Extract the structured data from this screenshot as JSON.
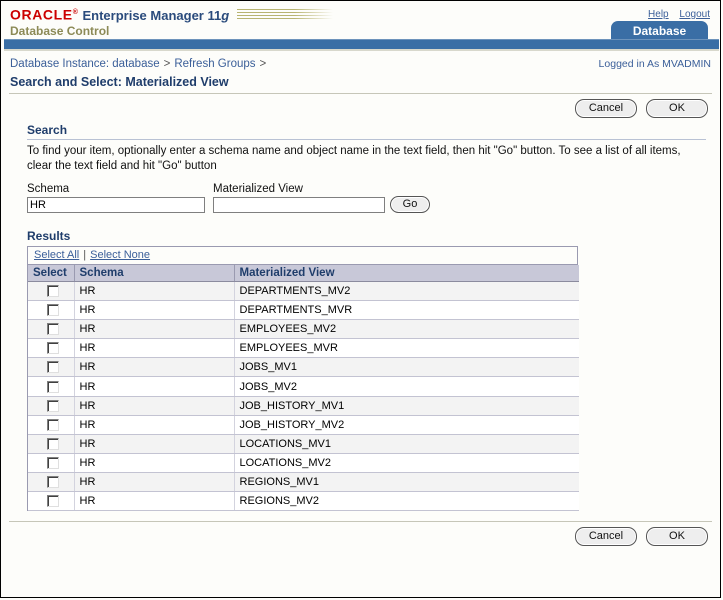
{
  "brand": {
    "oracle": "ORACLE",
    "product": "Enterprise Manager 11",
    "product_g": "g",
    "subtitle": "Database Control",
    "help_label": "Help",
    "logout_label": "Logout",
    "tab_label": "Database",
    "accent_blue": "#3a6ea5",
    "oracle_red": "#cc0000",
    "olive": "#8c8a56"
  },
  "breadcrumb": {
    "items": [
      {
        "label": "Database Instance: database"
      },
      {
        "label": "Refresh Groups"
      }
    ],
    "separator": ">",
    "logged_in": "Logged in As MVADMIN"
  },
  "page": {
    "title": "Search and Select: Materialized View"
  },
  "toolbar": {
    "cancel_label": "Cancel",
    "ok_label": "OK"
  },
  "search": {
    "heading": "Search",
    "description": "To find your item, optionally enter a schema name and object name in the text field, then hit \"Go\" button. To see a list of all items, clear the text field and hit \"Go\" button",
    "schema_label": "Schema",
    "schema_value": "HR",
    "schema_placeholder": "",
    "mview_label": "Materialized View",
    "mview_value": "",
    "mview_placeholder": "",
    "go_label": "Go"
  },
  "results": {
    "heading": "Results",
    "select_all_label": "Select All",
    "select_none_label": "Select None",
    "separator": "|",
    "columns": [
      "Select",
      "Schema",
      "Materialized View"
    ],
    "rows": [
      {
        "selected": false,
        "schema": "HR",
        "mview": "DEPARTMENTS_MV2"
      },
      {
        "selected": false,
        "schema": "HR",
        "mview": "DEPARTMENTS_MVR"
      },
      {
        "selected": false,
        "schema": "HR",
        "mview": "EMPLOYEES_MV2"
      },
      {
        "selected": false,
        "schema": "HR",
        "mview": "EMPLOYEES_MVR"
      },
      {
        "selected": false,
        "schema": "HR",
        "mview": "JOBS_MV1"
      },
      {
        "selected": false,
        "schema": "HR",
        "mview": "JOBS_MV2"
      },
      {
        "selected": false,
        "schema": "HR",
        "mview": "JOB_HISTORY_MV1"
      },
      {
        "selected": false,
        "schema": "HR",
        "mview": "JOB_HISTORY_MV2"
      },
      {
        "selected": false,
        "schema": "HR",
        "mview": "LOCATIONS_MV1"
      },
      {
        "selected": false,
        "schema": "HR",
        "mview": "LOCATIONS_MV2"
      },
      {
        "selected": false,
        "schema": "HR",
        "mview": "REGIONS_MV1"
      },
      {
        "selected": false,
        "schema": "HR",
        "mview": "REGIONS_MV2"
      }
    ]
  }
}
